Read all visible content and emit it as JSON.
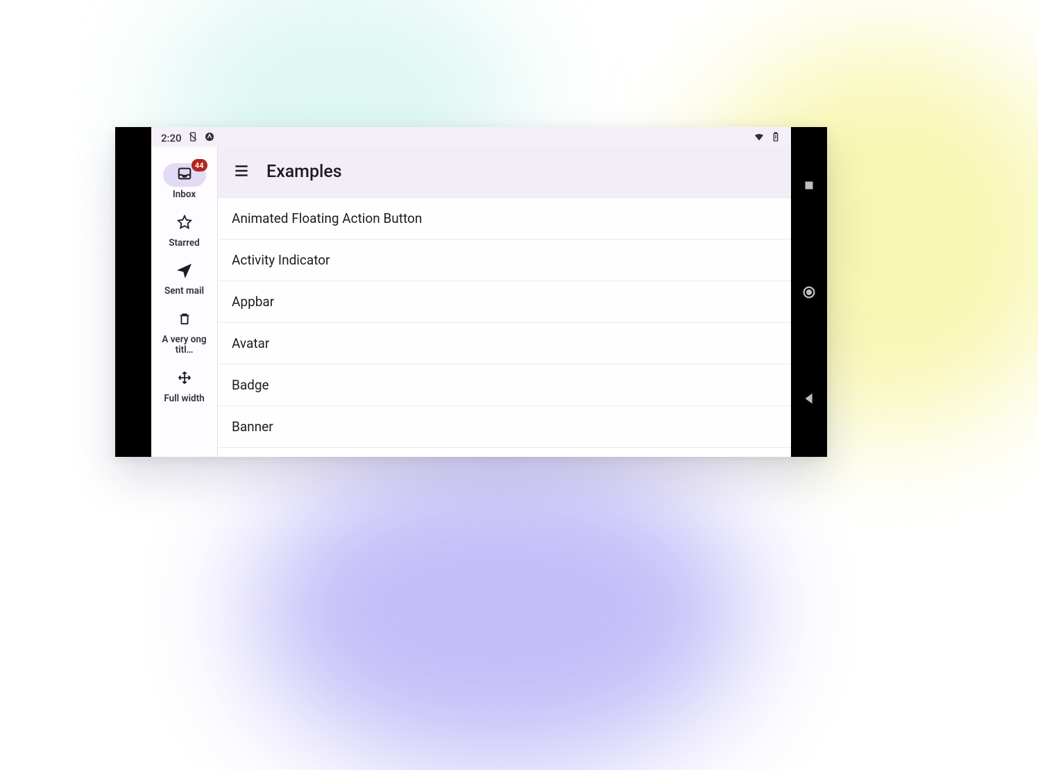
{
  "statusbar": {
    "time": "2:20"
  },
  "appbar": {
    "title": "Examples"
  },
  "rail": {
    "items": [
      {
        "label": "Inbox",
        "icon": "inbox",
        "badge": "44",
        "active": true
      },
      {
        "label": "Starred",
        "icon": "star",
        "badge": null,
        "active": false
      },
      {
        "label": "Sent mail",
        "icon": "send",
        "badge": null,
        "active": false
      },
      {
        "label": "A very ong titl…",
        "icon": "trash",
        "badge": null,
        "active": false
      },
      {
        "label": "Full width",
        "icon": "move",
        "badge": null,
        "active": false
      }
    ]
  },
  "list": {
    "items": [
      {
        "label": "Animated Floating Action Button"
      },
      {
        "label": "Activity Indicator"
      },
      {
        "label": "Appbar"
      },
      {
        "label": "Avatar"
      },
      {
        "label": "Badge"
      },
      {
        "label": "Banner"
      }
    ]
  }
}
